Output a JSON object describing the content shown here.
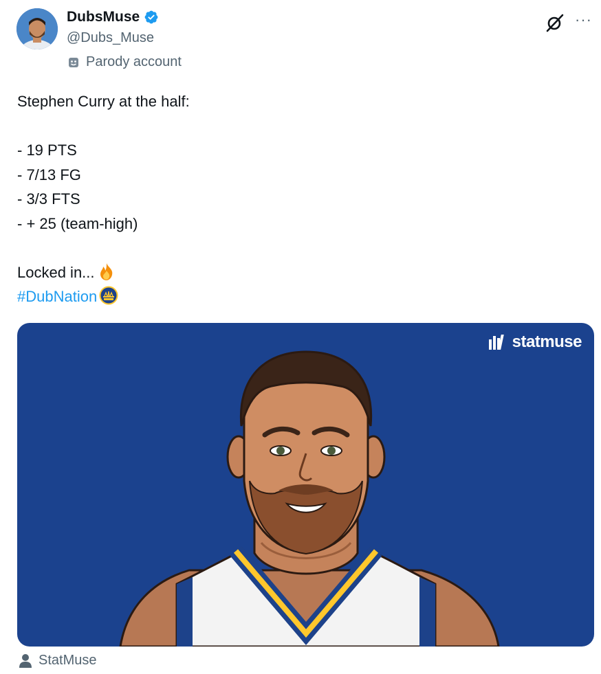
{
  "author": {
    "display_name": "DubsMuse",
    "handle": "@Dubs_Muse",
    "label": "Parody account",
    "verified": true,
    "avatar_icon": "avatar-photo"
  },
  "actions": {
    "grok_icon": "grok-icon",
    "more_icon": "more-options-icon"
  },
  "post": {
    "lines": [
      "Stephen Curry at the half:",
      "",
      "- 19 PTS",
      "- 7/13 FG",
      "- 3/3 FTS",
      "- + 25 (team-high)",
      "",
      "Locked in..."
    ],
    "hashtag": "#DubNation",
    "emoji_after_locked": "fire-emoji",
    "emoji_after_hashtag": "warriors-logo-emoji"
  },
  "media": {
    "brand_text": "statmuse",
    "background_color": "#1b428e"
  },
  "attribution": {
    "text": "StatMuse"
  },
  "colors": {
    "link": "#1d9bf0",
    "secondary_text": "#536471",
    "verified_badge": "#1d9bf0"
  }
}
